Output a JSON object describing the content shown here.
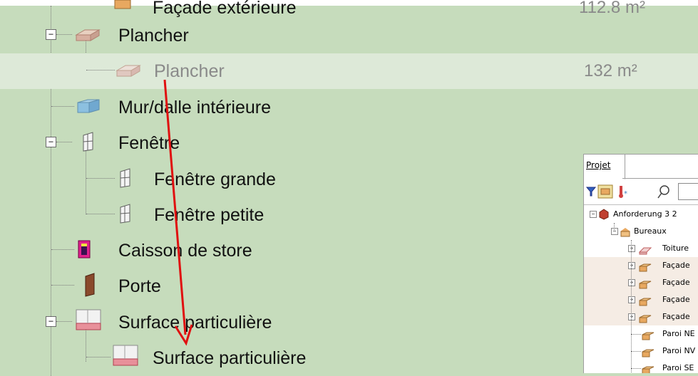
{
  "tree": {
    "top_row": {
      "label": "Façade extérieure",
      "value": "112.8 m²"
    },
    "rows": [
      {
        "label": "Plancher",
        "expander": "−"
      },
      {
        "label": "Plancher",
        "value": "132 m²"
      },
      {
        "label": "Mur/dalle intérieure"
      },
      {
        "label": "Fenêtre",
        "expander": "−"
      },
      {
        "label": "Fenêtre grande"
      },
      {
        "label": "Fenêtre petite"
      },
      {
        "label": "Caisson de store"
      },
      {
        "label": "Porte"
      },
      {
        "label": "Surface particulière",
        "expander": "−"
      },
      {
        "label": "Surface particulière"
      }
    ]
  },
  "panel": {
    "tab_label": "Projet",
    "tree": [
      {
        "label": "Anforderung 3 2",
        "expander": "−"
      },
      {
        "label": "Bureaux",
        "expander": "−"
      },
      {
        "label": "Toiture",
        "expander": "+"
      },
      {
        "label": "Façade",
        "expander": "+"
      },
      {
        "label": "Façade",
        "expander": "+"
      },
      {
        "label": "Façade",
        "expander": "+"
      },
      {
        "label": "Façade",
        "expander": "+"
      },
      {
        "label": "Paroi NE"
      },
      {
        "label": "Paroi NV"
      },
      {
        "label": "Paroi SE"
      }
    ]
  },
  "colors": {
    "background": "#c6dcbc",
    "selected_row": "#dde9d8",
    "arrow": "#e01010"
  }
}
